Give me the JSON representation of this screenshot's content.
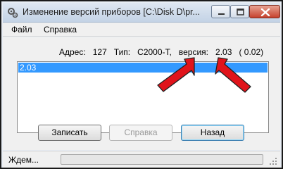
{
  "window": {
    "title": "Изменение версий приборов [C:\\Disk D\\pr...",
    "app_icon": "gears-icon",
    "close_icon": "close-icon"
  },
  "menu": {
    "items": [
      {
        "label": "Файл"
      },
      {
        "label": "Справка"
      }
    ]
  },
  "device": {
    "address_label": "Адрес:",
    "address": "127",
    "type_label": "Тип:",
    "type": "С2000-Т,",
    "version_label": "версия:",
    "version": "2.03",
    "sub_version": "( 0.02)"
  },
  "list": {
    "items": [
      {
        "label": "2.03",
        "selected": true
      }
    ]
  },
  "buttons": {
    "write": "Записать",
    "help": "Справка",
    "back": "Назад"
  },
  "status": {
    "text": "Ждем...",
    "progress": 0
  },
  "colors": {
    "selection": "#3399ff",
    "annotation_arrow": "#e0141b"
  }
}
